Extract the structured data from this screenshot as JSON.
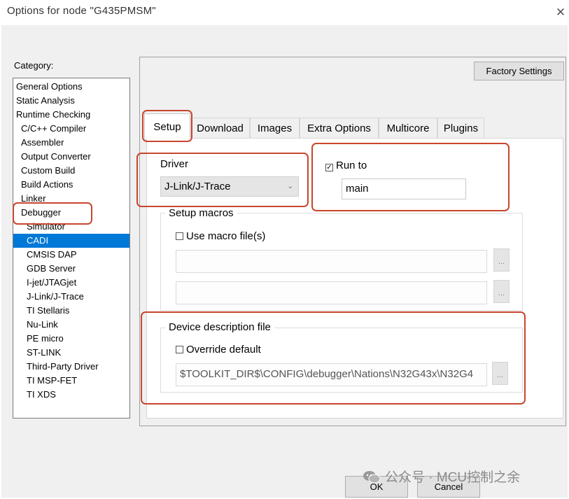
{
  "window": {
    "title": "Options for node \"G435PMSM\"",
    "close_icon": "✕"
  },
  "category": {
    "label": "Category:",
    "selected_index": 11,
    "items": [
      {
        "label": "General Options",
        "indent": 0
      },
      {
        "label": "Static Analysis",
        "indent": 0
      },
      {
        "label": "Runtime Checking",
        "indent": 0
      },
      {
        "label": "C/C++ Compiler",
        "indent": 1
      },
      {
        "label": "Assembler",
        "indent": 1
      },
      {
        "label": "Output Converter",
        "indent": 1
      },
      {
        "label": "Custom Build",
        "indent": 1
      },
      {
        "label": "Build Actions",
        "indent": 1
      },
      {
        "label": "Linker",
        "indent": 1
      },
      {
        "label": "Debugger",
        "indent": 1
      },
      {
        "label": "Simulator",
        "indent": 2
      },
      {
        "label": "CADI",
        "indent": 2
      },
      {
        "label": "CMSIS DAP",
        "indent": 2
      },
      {
        "label": "GDB Server",
        "indent": 2
      },
      {
        "label": "I-jet/JTAGjet",
        "indent": 2
      },
      {
        "label": "J-Link/J-Trace",
        "indent": 2
      },
      {
        "label": "TI Stellaris",
        "indent": 2
      },
      {
        "label": "Nu-Link",
        "indent": 2
      },
      {
        "label": "PE micro",
        "indent": 2
      },
      {
        "label": "ST-LINK",
        "indent": 2
      },
      {
        "label": "Third-Party Driver",
        "indent": 2
      },
      {
        "label": "TI MSP-FET",
        "indent": 2
      },
      {
        "label": "TI XDS",
        "indent": 2
      }
    ]
  },
  "factory_settings_label": "Factory Settings",
  "tabs": [
    {
      "label": "Setup",
      "active": true
    },
    {
      "label": "Download",
      "active": false
    },
    {
      "label": "Images",
      "active": false
    },
    {
      "label": "Extra Options",
      "active": false
    },
    {
      "label": "Multicore",
      "active": false
    },
    {
      "label": "Plugins",
      "active": false
    }
  ],
  "setup": {
    "driver_label": "Driver",
    "driver_value": "J-Link/J-Trace",
    "run_to_label": "Run to",
    "run_to_checked": true,
    "run_to_value": "main",
    "setup_macros_label": "Setup macros",
    "use_macro_label": "Use macro file(s)",
    "use_macro_checked": false,
    "macro_file_1": "",
    "macro_file_2": "",
    "browse_label": "...",
    "device_desc_label": "Device description file",
    "override_label": "Override default",
    "override_checked": false,
    "device_desc_value": "$TOOLKIT_DIR$\\CONFIG\\debugger\\Nations\\N32G43x\\N32G4"
  },
  "buttons": {
    "ok": "OK",
    "cancel": "Cancel"
  },
  "watermark": "公众号 · MCU控制之余",
  "highlight_color": "#c8462e",
  "selection_color": "#0078d7"
}
